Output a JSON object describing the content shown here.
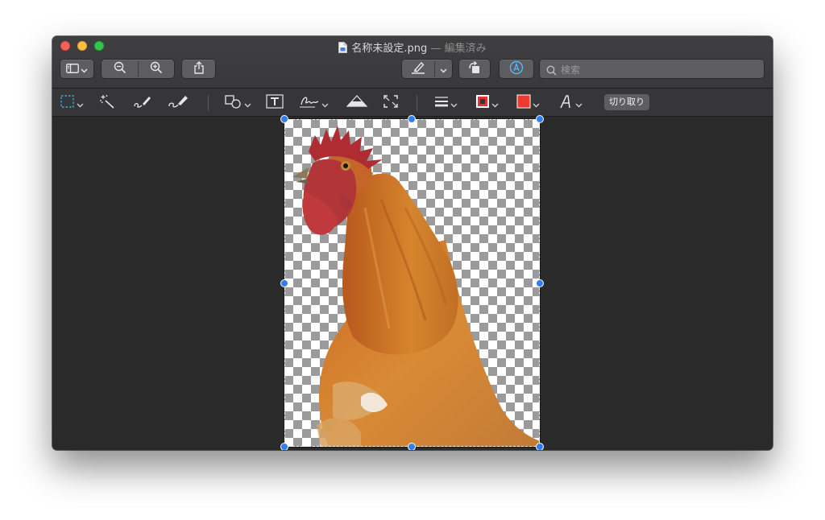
{
  "window": {
    "title": "名称未設定.png",
    "title_separator": "—",
    "edit_status": "編集済み"
  },
  "toolbar": {
    "buttons": [
      {
        "name": "sidebar-view-button",
        "icon": "sidebar-icon"
      },
      {
        "name": "zoom-out-button",
        "icon": "zoom-out-icon"
      },
      {
        "name": "zoom-in-button",
        "icon": "zoom-in-icon"
      },
      {
        "name": "share-button",
        "icon": "share-icon"
      },
      {
        "name": "highlight-button",
        "icon": "highlighter-icon"
      },
      {
        "name": "rotate-button",
        "icon": "rotate-left-icon"
      },
      {
        "name": "markup-toolbar-button",
        "icon": "markup-icon"
      }
    ],
    "search": {
      "placeholder": "検索",
      "value": ""
    }
  },
  "markup_bar": {
    "tools": [
      {
        "name": "rectangular-selection-tool",
        "icon": "rect-select-icon"
      },
      {
        "name": "instant-alpha-tool",
        "icon": "magic-wand-icon"
      },
      {
        "name": "sketch-tool",
        "icon": "sketch-icon"
      },
      {
        "name": "draw-tool",
        "icon": "draw-icon"
      },
      {
        "name": "shapes-tool",
        "icon": "shapes-icon"
      },
      {
        "name": "text-tool",
        "icon": "text-box-icon"
      },
      {
        "name": "sign-tool",
        "icon": "signature-icon"
      },
      {
        "name": "adjust-color-tool",
        "icon": "adjust-color-icon"
      },
      {
        "name": "adjust-size-tool",
        "icon": "resize-icon"
      },
      {
        "name": "shape-style-tool",
        "icon": "line-style-icon"
      },
      {
        "name": "border-color-tool",
        "icon": "border-color-icon"
      },
      {
        "name": "fill-color-tool",
        "icon": "fill-color-icon"
      },
      {
        "name": "text-style-tool",
        "icon": "text-style-icon"
      }
    ],
    "crop_label": "切り取り",
    "colors": {
      "border": "#e8322d",
      "fill": "#f03a2e",
      "selection_accent": "#3aa7e6"
    }
  },
  "canvas": {
    "image_subject": "rooster-photo",
    "selection_handle_color": "#2f7ff2"
  }
}
